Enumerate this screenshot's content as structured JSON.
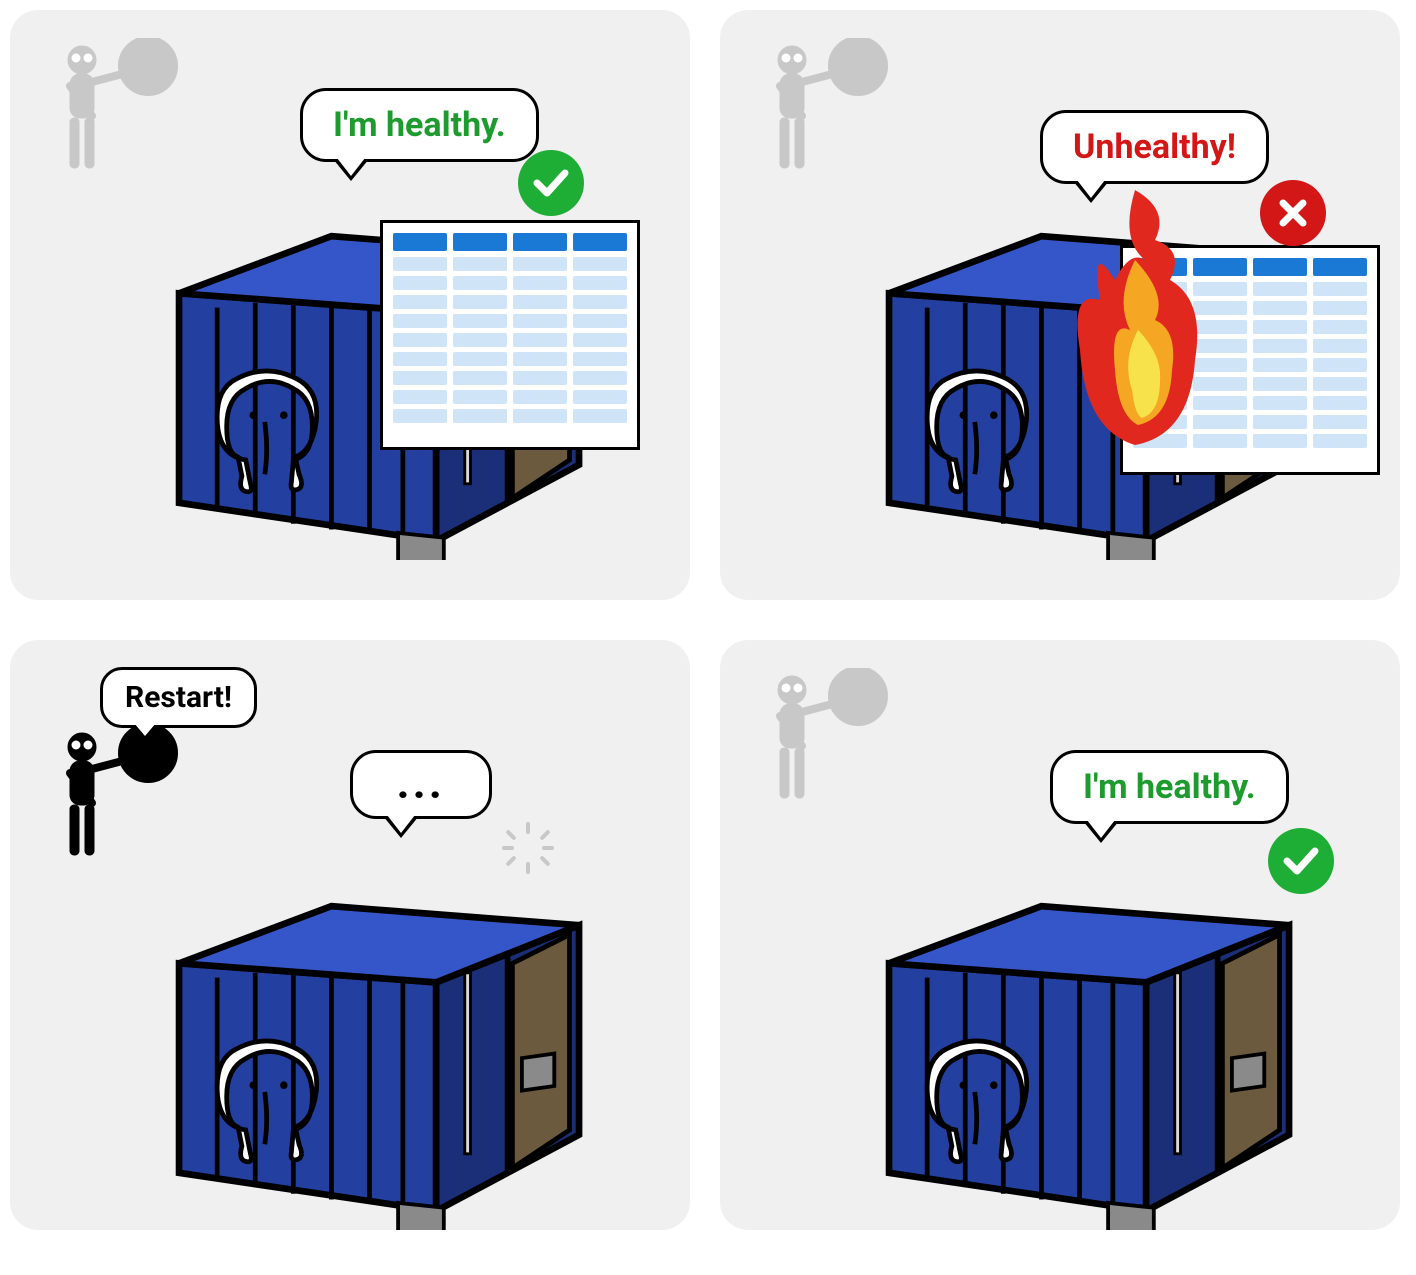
{
  "panels": {
    "p1": {
      "inspector_state": "idle",
      "container_speech": "I'm healthy.",
      "container_speech_color": "green",
      "status": "ok",
      "has_table": true,
      "has_fire": false,
      "has_spinner": false
    },
    "p2": {
      "inspector_state": "idle",
      "container_speech": "Unhealthy!",
      "container_speech_color": "red",
      "status": "err",
      "has_table": true,
      "has_fire": true,
      "has_spinner": false
    },
    "p3": {
      "inspector_state": "active",
      "inspector_speech": "Restart!",
      "container_speech": "...",
      "container_speech_color": "black",
      "status": "none",
      "has_table": false,
      "has_fire": false,
      "has_spinner": true
    },
    "p4": {
      "inspector_state": "idle",
      "container_speech": "I'm healthy.",
      "container_speech_color": "green",
      "status": "ok",
      "has_table": false,
      "has_fire": false,
      "has_spinner": false
    }
  },
  "icons": {
    "inspector": "inspector-with-magnifier-icon",
    "container": "shipping-container-postgres-icon",
    "elephant": "postgresql-elephant-icon",
    "check": "checkmark-icon",
    "cross": "cross-icon",
    "fire": "fire-icon",
    "spinner": "loading-spinner-icon",
    "table": "database-table-icon"
  },
  "colors": {
    "panel_bg": "#f0f0f0",
    "container_blue": "#233fa0",
    "container_blue_light": "#3556c8",
    "healthy_green": "#1e9b2e",
    "unhealthy_red": "#d31616",
    "badge_ok": "#1fae35",
    "badge_err": "#d31616",
    "table_header": "#1b79d6",
    "table_cell": "#cfe4f7",
    "fire_outer": "#e0281e",
    "fire_mid": "#f5a623",
    "fire_inner": "#f7e24b"
  }
}
